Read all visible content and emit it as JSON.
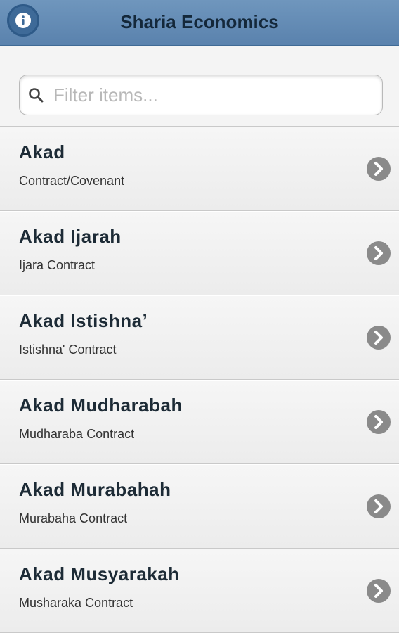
{
  "header": {
    "title": "Sharia Economics",
    "info_icon": "info-icon"
  },
  "search": {
    "placeholder": "Filter items...",
    "value": "",
    "icon": "search-icon"
  },
  "items": [
    {
      "title": "Akad",
      "subtitle": "Contract/Covenant"
    },
    {
      "title": "Akad Ijarah",
      "subtitle": "Ijara Contract"
    },
    {
      "title": "Akad Istishna’",
      "subtitle": "Istishna' Contract"
    },
    {
      "title": "Akad Mudharabah",
      "subtitle": "Mudharaba Contract"
    },
    {
      "title": "Akad Murabahah",
      "subtitle": "Murabaha Contract"
    },
    {
      "title": "Akad Musyarakah",
      "subtitle": "Musharaka Contract"
    }
  ],
  "colors": {
    "header_bg": "#5f88b3",
    "title_text": "#14283a",
    "chevron_bg": "#8a8a8a"
  }
}
